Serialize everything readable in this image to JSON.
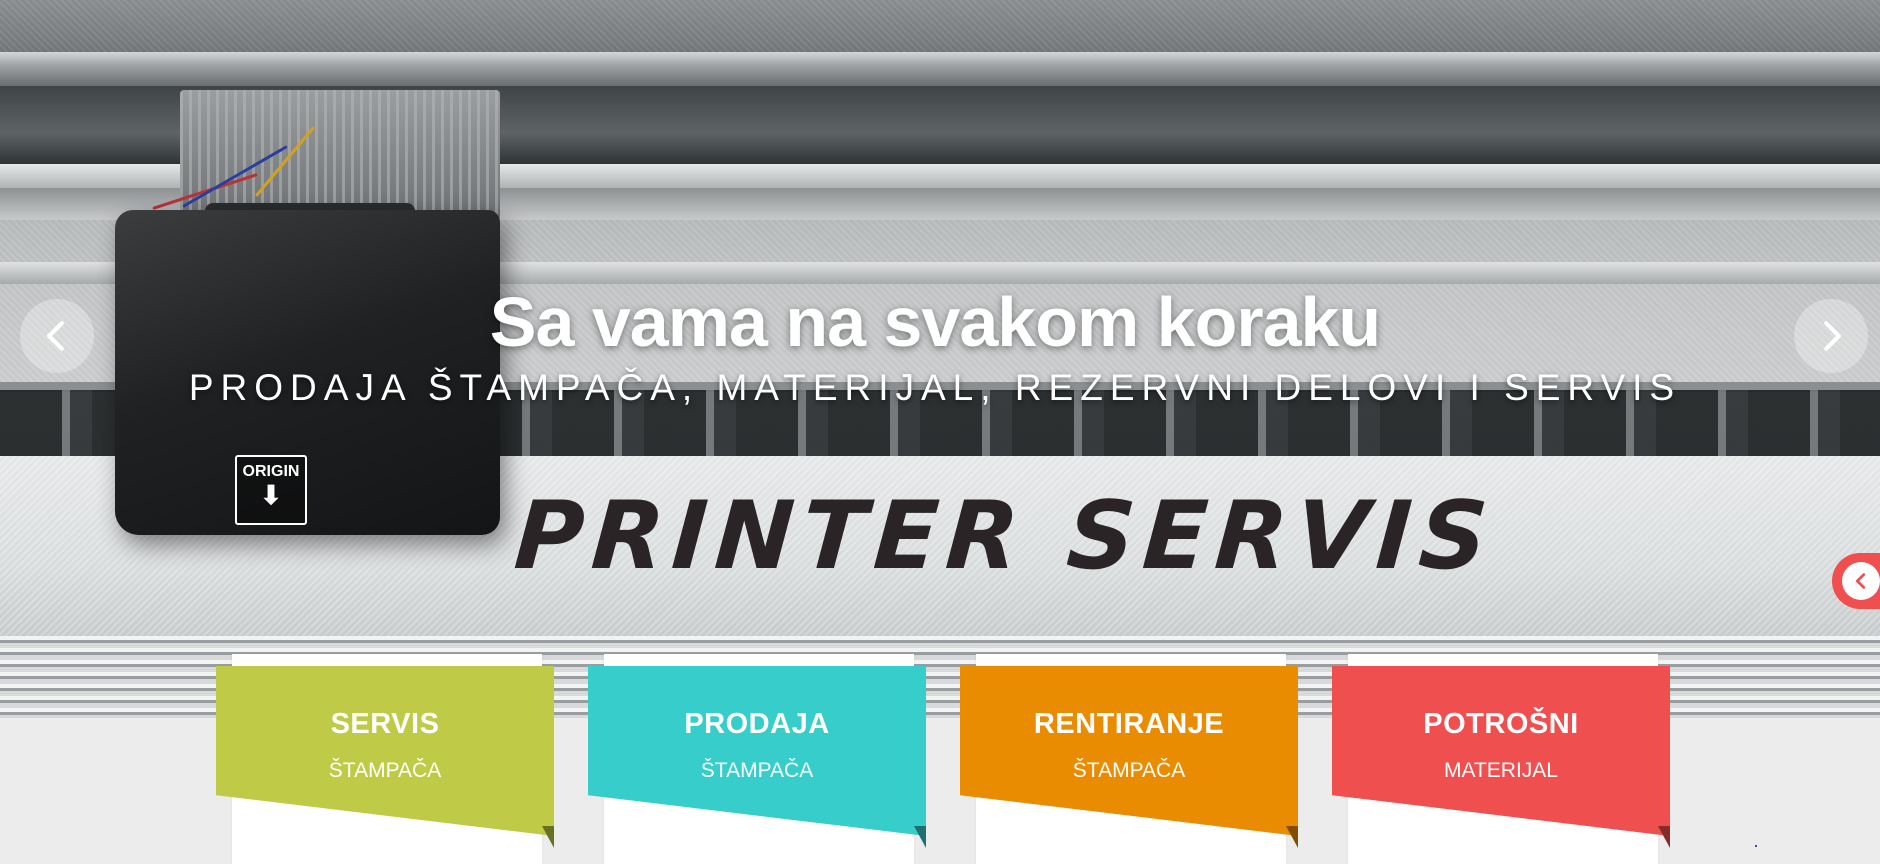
{
  "hero": {
    "title": "Sa vama na svakom koraku",
    "subtitle": "PRODAJA ŠTAMPAČA, MATERIJAL, REZERVNI DELOVI I SERVIS",
    "photo": {
      "badge_text": "ORIGIN",
      "brand_text": "PRINTER SERVIS"
    }
  },
  "carousel": {
    "prev_icon": "chevron-left-icon",
    "next_icon": "chevron-right-icon"
  },
  "side_tab": {
    "icon": "chevron-left-icon",
    "color": "#f04f4f"
  },
  "services": [
    {
      "title": "SERVIS",
      "subtitle": "ŠTAMPAČA",
      "color": "#bfca47"
    },
    {
      "title": "PRODAJA",
      "subtitle": "ŠTAMPAČA",
      "color": "#37cdca"
    },
    {
      "title": "RENTIRANJE",
      "subtitle": "ŠTAMPAČA",
      "color": "#e98c02"
    },
    {
      "title": "POTROŠNI",
      "subtitle": "MATERIJAL",
      "color": "#f04f4f"
    }
  ]
}
